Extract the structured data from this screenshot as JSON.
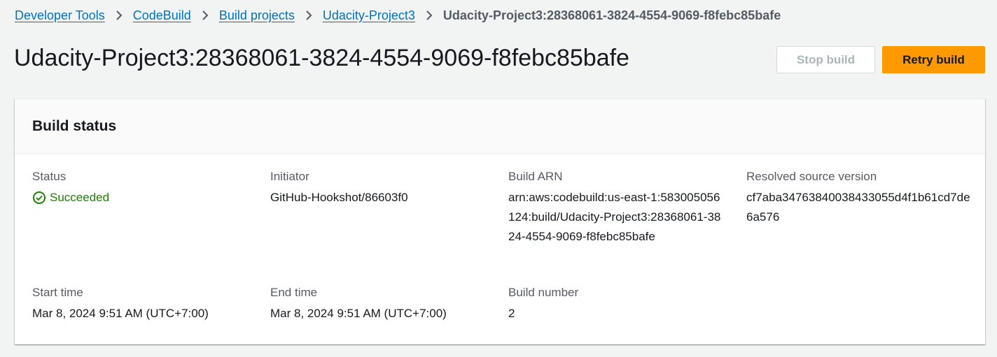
{
  "breadcrumb": {
    "items": [
      {
        "label": "Developer Tools"
      },
      {
        "label": "CodeBuild"
      },
      {
        "label": "Build projects"
      },
      {
        "label": "Udacity-Project3"
      }
    ],
    "current": "Udacity-Project3:28368061-3824-4554-9069-f8febc85bafe",
    "separator_icon": "chevron-right-icon"
  },
  "header": {
    "title": "Udacity-Project3:28368061-3824-4554-9069-f8febc85bafe",
    "stop_label": "Stop build",
    "retry_label": "Retry build"
  },
  "build_status": {
    "title": "Build status",
    "status_label": "Status",
    "status_value": "Succeeded",
    "status_icon": "check-circle-icon",
    "status_color": "#1d8102",
    "initiator_label": "Initiator",
    "initiator_value": "GitHub-Hookshot/86603f0",
    "arn_label": "Build ARN",
    "arn_value": "arn:aws:codebuild:us-east-1:583005056124:build/Udacity-Project3:28368061-3824-4554-9069-f8febc85bafe",
    "source_label": "Resolved source version",
    "source_value": "cf7aba34763840038433055d4f1b61cd7de6a576",
    "start_label": "Start time",
    "start_value": "Mar 8, 2024 9:51 AM (UTC+7:00)",
    "end_label": "End time",
    "end_value": "Mar 8, 2024 9:51 AM (UTC+7:00)",
    "number_label": "Build number",
    "number_value": "2"
  },
  "colors": {
    "link": "#0073bb",
    "primary_button": "#ff9900",
    "background": "#f2f3f3"
  }
}
